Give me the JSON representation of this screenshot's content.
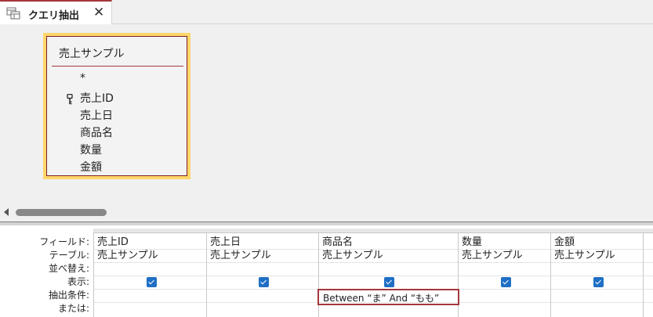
{
  "tab": {
    "title": "クエリ抽出",
    "close": "✕",
    "icon": "query-icon"
  },
  "table_box": {
    "name": "売上サンプル",
    "fields": [
      "*",
      "売上ID",
      "売上日",
      "商品名",
      "数量",
      "金額"
    ],
    "key_field_index": 1
  },
  "grid": {
    "row_labels": {
      "field": "フィールド:",
      "table": "テーブル:",
      "sort": "並べ替え:",
      "show": "表示:",
      "criteria": "抽出条件:",
      "or": "または:"
    },
    "columns": [
      {
        "field": "売上ID",
        "table": "売上サンプル",
        "show": true,
        "criteria": ""
      },
      {
        "field": "売上日",
        "table": "売上サンプル",
        "show": true,
        "criteria": ""
      },
      {
        "field": "商品名",
        "table": "売上サンプル",
        "show": true,
        "criteria": "Between “ま” And “もも”"
      },
      {
        "field": "数量",
        "table": "売上サンプル",
        "show": true,
        "criteria": ""
      },
      {
        "field": "金額",
        "table": "売上サンプル",
        "show": true,
        "criteria": ""
      }
    ]
  },
  "colors": {
    "accent": "#a4373a",
    "table_highlight": "#ffd66a",
    "checkbox": "#1f6fc5"
  }
}
